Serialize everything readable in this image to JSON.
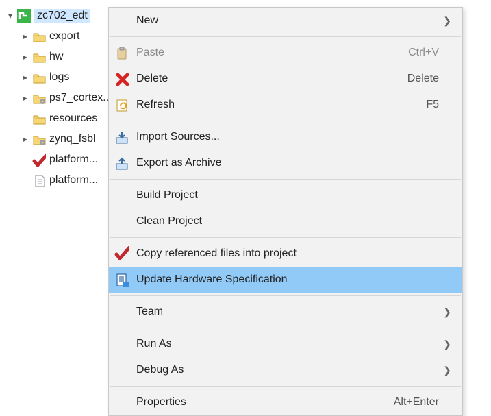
{
  "tree": {
    "root": {
      "label": "zc702_edt",
      "expanded": true
    },
    "items": [
      {
        "label": "export",
        "icon": "folder",
        "expandable": true
      },
      {
        "label": "hw",
        "icon": "folder",
        "expandable": true
      },
      {
        "label": "logs",
        "icon": "folder",
        "expandable": true
      },
      {
        "label": "ps7_cortex...",
        "icon": "folder-gear",
        "expandable": true
      },
      {
        "label": "resources",
        "icon": "folder",
        "expandable": false
      },
      {
        "label": "zynq_fsbl",
        "icon": "folder-gear",
        "expandable": true
      },
      {
        "label": "platform...",
        "icon": "check-red",
        "expandable": false
      },
      {
        "label": "platform...",
        "icon": "file",
        "expandable": false
      }
    ]
  },
  "menu": {
    "items": [
      {
        "label": "New",
        "icon": "",
        "submenu": true
      },
      {
        "sep": true
      },
      {
        "label": "Paste",
        "icon": "paste",
        "accel": "Ctrl+V",
        "disabled": true
      },
      {
        "label": "Delete",
        "icon": "delete-x",
        "accel": "Delete"
      },
      {
        "label": "Refresh",
        "icon": "refresh",
        "accel": "F5"
      },
      {
        "sep": true
      },
      {
        "label": "Import Sources...",
        "icon": "import"
      },
      {
        "label": "Export as Archive",
        "icon": "export"
      },
      {
        "sep": true
      },
      {
        "label": "Build Project",
        "icon": ""
      },
      {
        "label": "Clean Project",
        "icon": ""
      },
      {
        "sep": true
      },
      {
        "label": "Copy referenced files into project",
        "icon": "check-red"
      },
      {
        "label": "Update Hardware Specification",
        "icon": "doc-blue",
        "highlight": true
      },
      {
        "sep": true
      },
      {
        "label": "Team",
        "icon": "",
        "submenu": true
      },
      {
        "sep": true
      },
      {
        "label": "Run As",
        "icon": "",
        "submenu": true
      },
      {
        "label": "Debug As",
        "icon": "",
        "submenu": true
      },
      {
        "sep": true
      },
      {
        "label": "Properties",
        "icon": "",
        "accel": "Alt+Enter"
      }
    ]
  }
}
